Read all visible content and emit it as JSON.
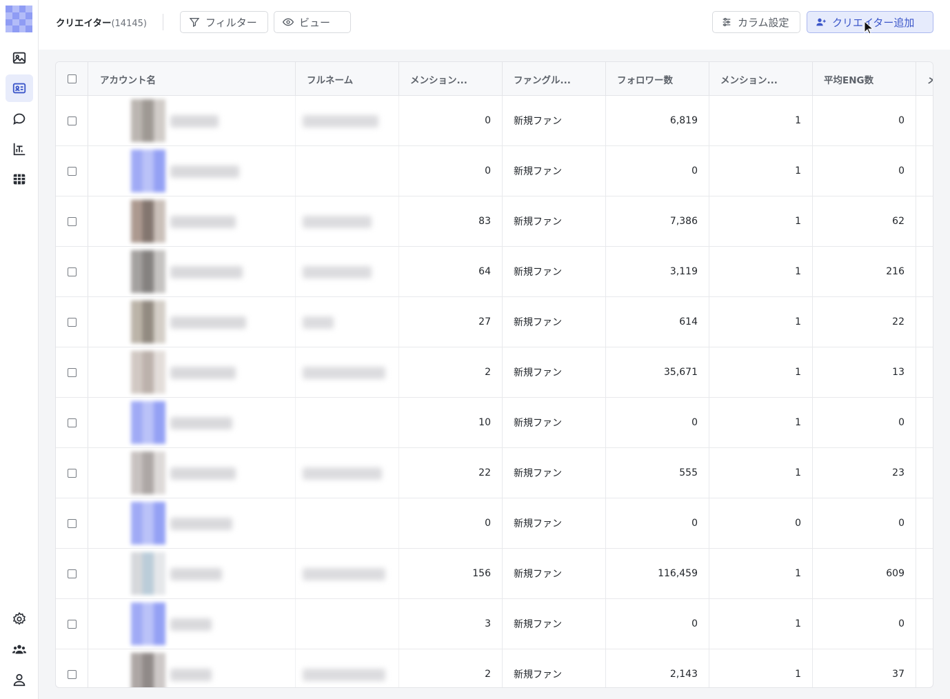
{
  "header": {
    "title": "クリエイター",
    "count": "(14145)",
    "filter_label": "フィルター",
    "view_label": "ビュー",
    "column_settings_label": "カラム設定",
    "add_creator_label": "クリエイター追加"
  },
  "sidebar": {
    "items": [
      {
        "icon": "image-icon",
        "active": false
      },
      {
        "icon": "id-card-icon",
        "active": true
      },
      {
        "icon": "chat-bubble-icon",
        "active": false
      },
      {
        "icon": "bar-chart-icon",
        "active": false
      },
      {
        "icon": "table-grid-icon",
        "active": false
      }
    ],
    "bottom_items": [
      {
        "icon": "gear-icon"
      },
      {
        "icon": "team-icon"
      },
      {
        "icon": "user-icon"
      }
    ]
  },
  "table": {
    "columns": [
      "アカウント名",
      "フルネーム",
      "メンション...",
      "ファングル...",
      "フォロワー数",
      "メンション...",
      "平均ENG数",
      "メ"
    ],
    "rows": [
      {
        "mentions": "0",
        "fan_group": "新規ファン",
        "followers": "6,819",
        "mentions2": "1",
        "avg_eng": "0"
      },
      {
        "mentions": "0",
        "fan_group": "新規ファン",
        "followers": "0",
        "mentions2": "1",
        "avg_eng": "0"
      },
      {
        "mentions": "83",
        "fan_group": "新規ファン",
        "followers": "7,386",
        "mentions2": "1",
        "avg_eng": "62"
      },
      {
        "mentions": "64",
        "fan_group": "新規ファン",
        "followers": "3,119",
        "mentions2": "1",
        "avg_eng": "216"
      },
      {
        "mentions": "27",
        "fan_group": "新規ファン",
        "followers": "614",
        "mentions2": "1",
        "avg_eng": "22"
      },
      {
        "mentions": "2",
        "fan_group": "新規ファン",
        "followers": "35,671",
        "mentions2": "1",
        "avg_eng": "13"
      },
      {
        "mentions": "10",
        "fan_group": "新規ファン",
        "followers": "0",
        "mentions2": "1",
        "avg_eng": "0"
      },
      {
        "mentions": "22",
        "fan_group": "新規ファン",
        "followers": "555",
        "mentions2": "1",
        "avg_eng": "23"
      },
      {
        "mentions": "0",
        "fan_group": "新規ファン",
        "followers": "0",
        "mentions2": "0",
        "avg_eng": "0"
      },
      {
        "mentions": "156",
        "fan_group": "新規ファン",
        "followers": "116,459",
        "mentions2": "1",
        "avg_eng": "609"
      },
      {
        "mentions": "3",
        "fan_group": "新規ファン",
        "followers": "0",
        "mentions2": "1",
        "avg_eng": "0"
      },
      {
        "mentions": "2",
        "fan_group": "新規ファン",
        "followers": "2,143",
        "mentions2": "1",
        "avg_eng": "37"
      }
    ]
  },
  "colors": {
    "accent": "#3b56c9",
    "accent_bg": "#e6ebfc",
    "logo_blue": "#8f9cf4"
  }
}
